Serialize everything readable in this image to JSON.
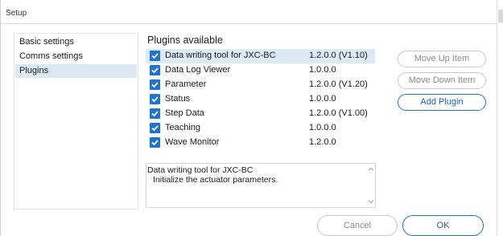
{
  "window": {
    "title": "Setup"
  },
  "nav": {
    "items": [
      {
        "label": "Basic settings",
        "selected": false
      },
      {
        "label": "Comms settings",
        "selected": false
      },
      {
        "label": "Plugins",
        "selected": true
      }
    ]
  },
  "plugins": {
    "heading": "Plugins available",
    "rows": [
      {
        "name": "Data writing tool for JXC-BC",
        "version": "1.2.0.0 (V1.10)",
        "checked": true,
        "selected": true
      },
      {
        "name": "Data Log Viewer",
        "version": "1.0.0.0",
        "checked": true,
        "selected": false
      },
      {
        "name": "Parameter",
        "version": "1.2.0.0 (V1.20)",
        "checked": true,
        "selected": false
      },
      {
        "name": "Status",
        "version": "1.0.0.0",
        "checked": true,
        "selected": false
      },
      {
        "name": "Step Data",
        "version": "1.2.0.0 (V1.00)",
        "checked": true,
        "selected": false
      },
      {
        "name": "Teaching",
        "version": "1.0.0.0",
        "checked": true,
        "selected": false
      },
      {
        "name": "Wave Monitor",
        "version": "1.2.0.0",
        "checked": true,
        "selected": false
      }
    ],
    "description": {
      "line1": "Data writing tool for JXC-BC",
      "line2": "Initialize the actuator parameters."
    }
  },
  "buttons": {
    "move_up": "Move Up Item",
    "move_down": "Move Down Item",
    "add_plugin": "Add Plugin",
    "cancel": "Cancel",
    "ok": "OK"
  },
  "colors": {
    "accent": "#1f74d0",
    "selection": "#dde8f5",
    "disabled_text": "#8a8a8a"
  },
  "icons": {
    "checkbox": "checkmark-icon",
    "scroll_up": "chevron-up-icon",
    "scroll_down": "chevron-down-icon"
  }
}
